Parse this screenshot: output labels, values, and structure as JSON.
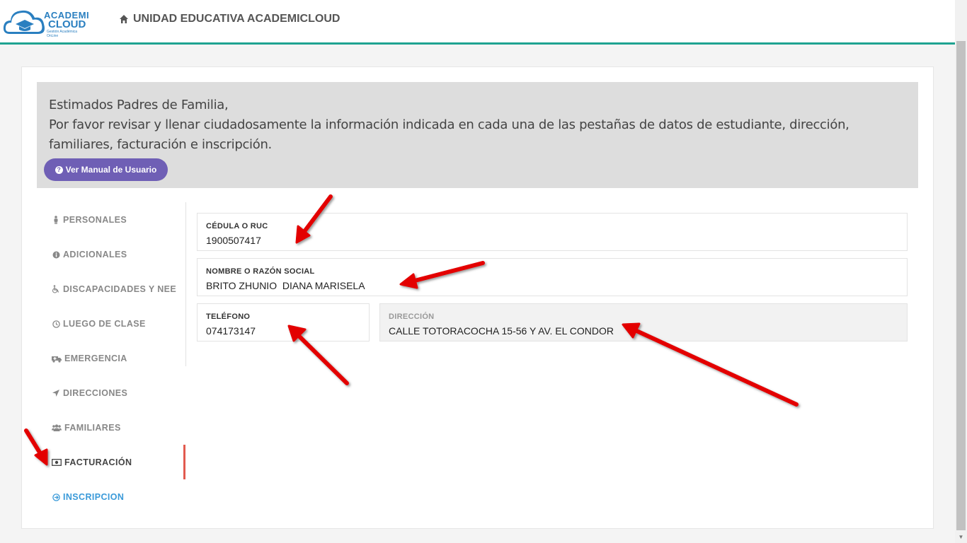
{
  "header": {
    "logo": {
      "line1": "ACADEMI",
      "line2": "CLOUD",
      "tagline": "Gestión Académica OnLine"
    },
    "school_title": "UNIDAD EDUCATIVA ACADEMICLOUD",
    "icon": "home-icon"
  },
  "notice": {
    "line1": "Estimados Padres de Familia,",
    "line2": "Por favor revisar y llenar ciudadosamente la información indicada en cada una de las pestañas de datos de estudiante, dirección, familiares, facturación e inscripción.",
    "button_label": "Ver Manual de Usuario",
    "button_color": "#6f5fb5"
  },
  "nav": {
    "items": [
      {
        "label": "PERSONALES",
        "icon": "person-icon"
      },
      {
        "label": "ADICIONALES",
        "icon": "info-icon"
      },
      {
        "label": "DISCAPACIDADES Y NEE",
        "icon": "wheelchair-icon"
      },
      {
        "label": "LUEGO DE CLASE",
        "icon": "clock-icon"
      },
      {
        "label": "EMERGENCIA",
        "icon": "ambulance-icon"
      },
      {
        "label": "DIRECCIONES",
        "icon": "location-arrow-icon"
      },
      {
        "label": "FAMILIARES",
        "icon": "users-icon"
      },
      {
        "label": "FACTURACIÓN",
        "icon": "money-icon",
        "active": true
      },
      {
        "label": "INSCRIPCION",
        "icon": "arrow-circle-icon",
        "link": true
      }
    ]
  },
  "form": {
    "cedula": {
      "label": "CÉDULA O RUC",
      "value": "1900507417"
    },
    "nombre": {
      "label": "NOMBRE O RAZÓN SOCIAL",
      "value": "BRITO ZHUNIO  DIANA MARISELA"
    },
    "telefono": {
      "label": "TELÉFONO",
      "value": "074173147"
    },
    "direccion": {
      "label": "DIRECCIÓN",
      "value": "CALLE TOTORACOCHA 15-56 Y AV. EL CONDOR"
    }
  },
  "colors": {
    "accent": "#1fa391",
    "active_bar": "#e25b4f",
    "link": "#3a9ad9",
    "annotation_arrow": "#e30000"
  }
}
